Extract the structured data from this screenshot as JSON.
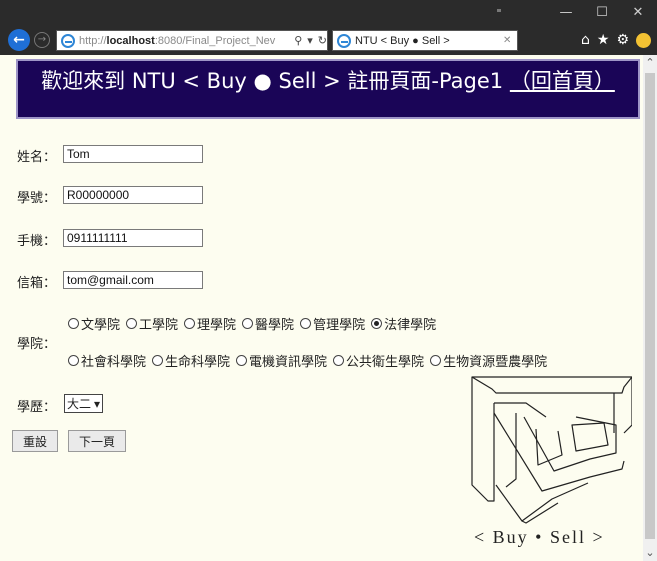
{
  "browser": {
    "url_prefix": "http://",
    "url_host": "localhost",
    "url_rest": ":8080/Final_Project_Nev",
    "tab_title": "NTU < Buy ● Sell >",
    "search_glyph": "⚲",
    "dropdown_glyph": "▾",
    "refresh_glyph": "↻",
    "tab_close_glyph": "✕",
    "back_glyph": "←",
    "forward_glyph": "→",
    "minimize_glyph": "—",
    "maximize_glyph": "☐",
    "close_glyph": "✕",
    "home_glyph": "⌂",
    "favorites_glyph": "★",
    "settings_glyph": "⚙"
  },
  "header": {
    "title": "歡迎來到 NTU < Buy ● Sell > 註冊頁面-Page1",
    "home_link": "（回首頁）"
  },
  "form": {
    "name": {
      "label": "姓名：",
      "value": "Tom"
    },
    "student_id": {
      "label": "學號：",
      "value": "R00000000"
    },
    "phone": {
      "label": "手機：",
      "value": "0911111111"
    },
    "email": {
      "label": "信箱：",
      "value": "tom@gmail.com"
    },
    "college": {
      "label": "學院：",
      "row1": [
        "文學院",
        "工學院",
        "理學院",
        "醫學院",
        "管理學院",
        "法律學院"
      ],
      "row2": [
        "社會科學院",
        "生命科學院",
        "電機資訊學院",
        "公共衛生學院",
        "生物資源暨農學院"
      ],
      "selected": "法律學院"
    },
    "degree": {
      "label": "學歷：",
      "value": "大二"
    },
    "reset_label": "重設",
    "next_label": "下一頁"
  },
  "logo": {
    "caption": "< Buy • Sell >"
  },
  "colors": {
    "header_bg": "#1a0557",
    "page_bg": "#fdfdf0",
    "chrome_bg": "#2b2b2b",
    "accent": "#1f6fd6"
  }
}
